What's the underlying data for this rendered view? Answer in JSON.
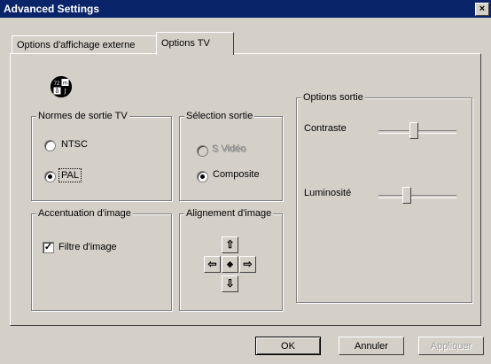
{
  "window": {
    "title": "Advanced Settings",
    "close_label": "×"
  },
  "tabs": [
    {
      "label": "Options d'affichage externe"
    },
    {
      "label": "Options TV"
    }
  ],
  "tv_logo": {
    "icon": "tv-logo-icon",
    "q1": "72",
    "q2": "m",
    "q3": "δ",
    "q4": "∫"
  },
  "normes": {
    "title": "Normes de sortie TV",
    "options": [
      {
        "label": "NTSC",
        "checked": false
      },
      {
        "label": "PAL",
        "checked": true
      }
    ]
  },
  "selection": {
    "title": "Sélection sortie",
    "options": [
      {
        "label": "S Vidéo",
        "checked": false,
        "disabled": true
      },
      {
        "label": "Composite",
        "checked": true,
        "disabled": false
      }
    ]
  },
  "accentuation": {
    "title": "Accentuation d'image",
    "checkbox_label": "Filtre d'image",
    "checked": true,
    "check_glyph": "✓"
  },
  "alignement": {
    "title": "Alignement d'image",
    "up": "⇧",
    "left": "⇦",
    "center": "◆",
    "right": "⇨",
    "down": "⇩"
  },
  "options_sortie": {
    "title": "Options sortie",
    "contraste_label": "Contraste",
    "contraste_level": 0.45,
    "luminosite_label": "Luminosité",
    "luminosite_level": 0.35
  },
  "buttons": {
    "ok": "OK",
    "annuler": "Annuler",
    "appliquer": "Appliquer"
  }
}
